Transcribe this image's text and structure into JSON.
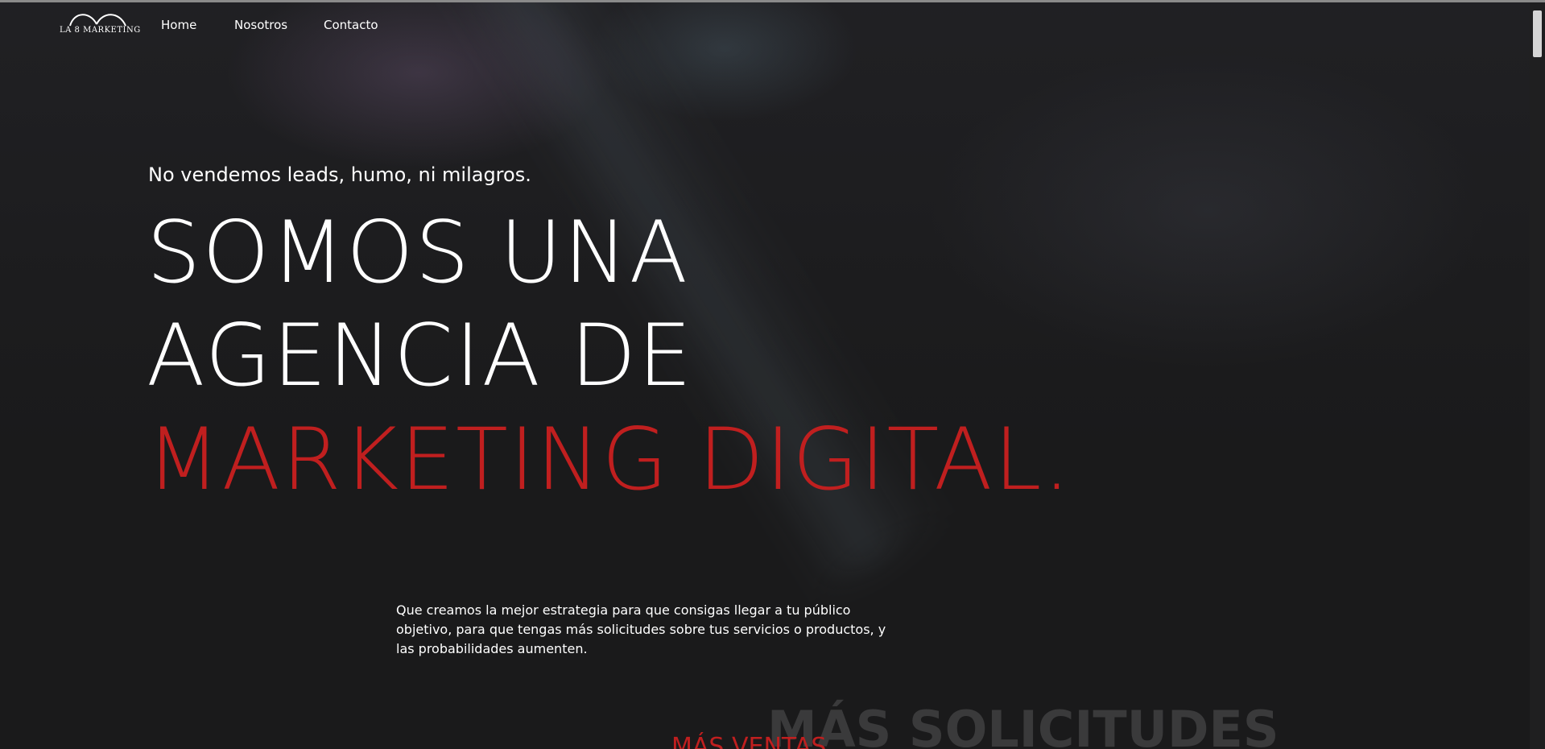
{
  "brand": {
    "logo_text": "LA 8 MARKETING",
    "accent_color": "#c01f1f",
    "background_color": "#1a1a1b"
  },
  "nav": {
    "items": [
      {
        "label": "Home"
      },
      {
        "label": "Nosotros"
      },
      {
        "label": "Contacto"
      }
    ]
  },
  "hero": {
    "tagline": "No vendemos leads, humo, ni milagros.",
    "headline_line1": "SOMOS UNA",
    "headline_line2": "AGENCIA DE",
    "headline_line3": "MARKETING DIGITAL."
  },
  "intro": {
    "text": "Que creamos la mejor estrategia para que consigas llegar a tu público objetivo, para que tengas más solicitudes sobre tus servicios o productos, y las probabilidades aumenten."
  },
  "features": {
    "ghost_heading": "MÁS SOLICITUDES",
    "accent_heading": "MÁS VENTAS"
  },
  "icons": {
    "logo": "double-arch-logo-icon"
  }
}
